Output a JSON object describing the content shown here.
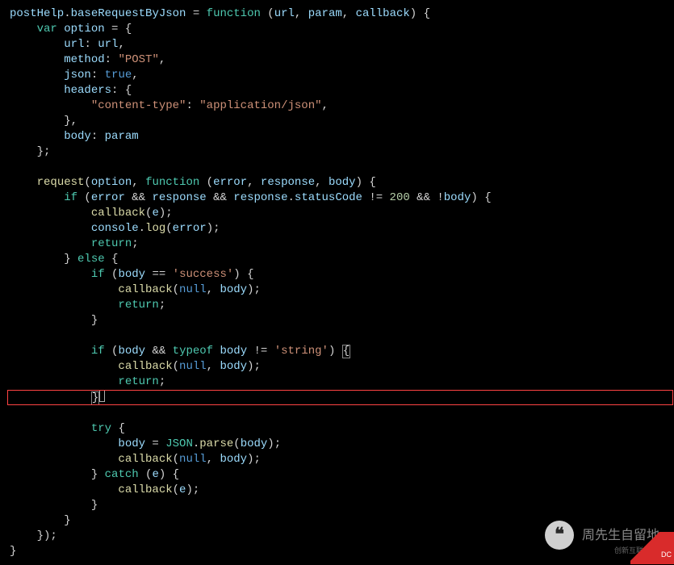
{
  "code_lines": [
    {
      "indent": 0,
      "tokens": [
        {
          "t": "prop",
          "v": "postHelp"
        },
        {
          "t": "punct",
          "v": "."
        },
        {
          "t": "prop",
          "v": "baseRequestByJson"
        },
        {
          "t": "punct",
          "v": " = "
        },
        {
          "t": "kw",
          "v": "function"
        },
        {
          "t": "punct",
          "v": " ("
        },
        {
          "t": "prop",
          "v": "url"
        },
        {
          "t": "punct",
          "v": ", "
        },
        {
          "t": "prop",
          "v": "param"
        },
        {
          "t": "punct",
          "v": ", "
        },
        {
          "t": "prop",
          "v": "callback"
        },
        {
          "t": "punct",
          "v": ") {"
        }
      ]
    },
    {
      "indent": 1,
      "tokens": [
        {
          "t": "kw",
          "v": "var"
        },
        {
          "t": "punct",
          "v": " "
        },
        {
          "t": "prop",
          "v": "option"
        },
        {
          "t": "punct",
          "v": " = {"
        }
      ]
    },
    {
      "indent": 2,
      "tokens": [
        {
          "t": "prop",
          "v": "url"
        },
        {
          "t": "punct",
          "v": ": "
        },
        {
          "t": "prop",
          "v": "url"
        },
        {
          "t": "punct",
          "v": ","
        }
      ]
    },
    {
      "indent": 2,
      "tokens": [
        {
          "t": "prop",
          "v": "method"
        },
        {
          "t": "punct",
          "v": ": "
        },
        {
          "t": "str",
          "v": "\"POST\""
        },
        {
          "t": "punct",
          "v": ","
        }
      ]
    },
    {
      "indent": 2,
      "tokens": [
        {
          "t": "prop",
          "v": "json"
        },
        {
          "t": "punct",
          "v": ": "
        },
        {
          "t": "null",
          "v": "true"
        },
        {
          "t": "punct",
          "v": ","
        }
      ]
    },
    {
      "indent": 2,
      "tokens": [
        {
          "t": "prop",
          "v": "headers"
        },
        {
          "t": "punct",
          "v": ": {"
        }
      ]
    },
    {
      "indent": 3,
      "tokens": [
        {
          "t": "str",
          "v": "\"content-type\""
        },
        {
          "t": "punct",
          "v": ": "
        },
        {
          "t": "str",
          "v": "\"application/json\""
        },
        {
          "t": "punct",
          "v": ","
        }
      ]
    },
    {
      "indent": 2,
      "tokens": [
        {
          "t": "punct",
          "v": "},"
        }
      ]
    },
    {
      "indent": 2,
      "tokens": [
        {
          "t": "prop",
          "v": "body"
        },
        {
          "t": "punct",
          "v": ": "
        },
        {
          "t": "prop",
          "v": "param"
        }
      ]
    },
    {
      "indent": 1,
      "tokens": [
        {
          "t": "punct",
          "v": "};"
        }
      ]
    },
    {
      "indent": 0,
      "tokens": []
    },
    {
      "indent": 1,
      "tokens": [
        {
          "t": "fn",
          "v": "request"
        },
        {
          "t": "punct",
          "v": "("
        },
        {
          "t": "prop",
          "v": "option"
        },
        {
          "t": "punct",
          "v": ", "
        },
        {
          "t": "kw",
          "v": "function"
        },
        {
          "t": "punct",
          "v": " ("
        },
        {
          "t": "prop",
          "v": "error"
        },
        {
          "t": "punct",
          "v": ", "
        },
        {
          "t": "prop",
          "v": "response"
        },
        {
          "t": "punct",
          "v": ", "
        },
        {
          "t": "prop",
          "v": "body"
        },
        {
          "t": "punct",
          "v": ") {"
        }
      ]
    },
    {
      "indent": 2,
      "tokens": [
        {
          "t": "kw",
          "v": "if"
        },
        {
          "t": "punct",
          "v": " ("
        },
        {
          "t": "prop",
          "v": "error"
        },
        {
          "t": "punct",
          "v": " && "
        },
        {
          "t": "prop",
          "v": "response"
        },
        {
          "t": "punct",
          "v": " && "
        },
        {
          "t": "prop",
          "v": "response"
        },
        {
          "t": "punct",
          "v": "."
        },
        {
          "t": "prop",
          "v": "statusCode"
        },
        {
          "t": "punct",
          "v": " != "
        },
        {
          "t": "num",
          "v": "200"
        },
        {
          "t": "punct",
          "v": " && !"
        },
        {
          "t": "prop",
          "v": "body"
        },
        {
          "t": "punct",
          "v": ") {"
        }
      ]
    },
    {
      "indent": 3,
      "tokens": [
        {
          "t": "fn",
          "v": "callback"
        },
        {
          "t": "punct",
          "v": "("
        },
        {
          "t": "prop",
          "v": "e"
        },
        {
          "t": "punct",
          "v": ");"
        }
      ]
    },
    {
      "indent": 3,
      "tokens": [
        {
          "t": "prop",
          "v": "console"
        },
        {
          "t": "punct",
          "v": "."
        },
        {
          "t": "fn",
          "v": "log"
        },
        {
          "t": "punct",
          "v": "("
        },
        {
          "t": "prop",
          "v": "error"
        },
        {
          "t": "punct",
          "v": ");"
        }
      ]
    },
    {
      "indent": 3,
      "tokens": [
        {
          "t": "kw",
          "v": "return"
        },
        {
          "t": "punct",
          "v": ";"
        }
      ]
    },
    {
      "indent": 2,
      "tokens": [
        {
          "t": "punct",
          "v": "} "
        },
        {
          "t": "kw",
          "v": "else"
        },
        {
          "t": "punct",
          "v": " {"
        }
      ]
    },
    {
      "indent": 3,
      "tokens": [
        {
          "t": "kw",
          "v": "if"
        },
        {
          "t": "punct",
          "v": " ("
        },
        {
          "t": "prop",
          "v": "body"
        },
        {
          "t": "punct",
          "v": " == "
        },
        {
          "t": "str",
          "v": "'success'"
        },
        {
          "t": "punct",
          "v": ") {"
        }
      ]
    },
    {
      "indent": 4,
      "tokens": [
        {
          "t": "fn",
          "v": "callback"
        },
        {
          "t": "punct",
          "v": "("
        },
        {
          "t": "null",
          "v": "null"
        },
        {
          "t": "punct",
          "v": ", "
        },
        {
          "t": "prop",
          "v": "body"
        },
        {
          "t": "punct",
          "v": ");"
        }
      ]
    },
    {
      "indent": 4,
      "tokens": [
        {
          "t": "kw",
          "v": "return"
        },
        {
          "t": "punct",
          "v": ";"
        }
      ]
    },
    {
      "indent": 3,
      "tokens": [
        {
          "t": "punct",
          "v": "}"
        }
      ]
    },
    {
      "indent": 0,
      "tokens": []
    },
    {
      "indent": 3,
      "tokens": [
        {
          "t": "kw",
          "v": "if"
        },
        {
          "t": "punct",
          "v": " ("
        },
        {
          "t": "prop",
          "v": "body"
        },
        {
          "t": "punct",
          "v": " && "
        },
        {
          "t": "kw",
          "v": "typeof"
        },
        {
          "t": "punct",
          "v": " "
        },
        {
          "t": "prop",
          "v": "body"
        },
        {
          "t": "punct",
          "v": " != "
        },
        {
          "t": "str",
          "v": "'string'"
        },
        {
          "t": "punct",
          "v": ") "
        },
        {
          "t": "bracket",
          "v": "{"
        }
      ]
    },
    {
      "indent": 4,
      "tokens": [
        {
          "t": "fn",
          "v": "callback"
        },
        {
          "t": "punct",
          "v": "("
        },
        {
          "t": "null",
          "v": "null"
        },
        {
          "t": "punct",
          "v": ", "
        },
        {
          "t": "prop",
          "v": "body"
        },
        {
          "t": "punct",
          "v": ");"
        }
      ]
    },
    {
      "indent": 4,
      "tokens": [
        {
          "t": "kw",
          "v": "return"
        },
        {
          "t": "punct",
          "v": ";"
        }
      ]
    },
    {
      "indent": 3,
      "tokens": [
        {
          "t": "cursor",
          "v": "}"
        }
      ]
    },
    {
      "indent": 0,
      "tokens": []
    },
    {
      "indent": 3,
      "tokens": [
        {
          "t": "kw",
          "v": "try"
        },
        {
          "t": "punct",
          "v": " {"
        }
      ]
    },
    {
      "indent": 4,
      "tokens": [
        {
          "t": "prop",
          "v": "body"
        },
        {
          "t": "punct",
          "v": " = "
        },
        {
          "t": "obj",
          "v": "JSON"
        },
        {
          "t": "punct",
          "v": "."
        },
        {
          "t": "fn",
          "v": "parse"
        },
        {
          "t": "punct",
          "v": "("
        },
        {
          "t": "prop",
          "v": "body"
        },
        {
          "t": "punct",
          "v": ");"
        }
      ]
    },
    {
      "indent": 4,
      "tokens": [
        {
          "t": "fn",
          "v": "callback"
        },
        {
          "t": "punct",
          "v": "("
        },
        {
          "t": "null",
          "v": "null"
        },
        {
          "t": "punct",
          "v": ", "
        },
        {
          "t": "prop",
          "v": "body"
        },
        {
          "t": "punct",
          "v": ");"
        }
      ]
    },
    {
      "indent": 3,
      "tokens": [
        {
          "t": "punct",
          "v": "} "
        },
        {
          "t": "kw",
          "v": "catch"
        },
        {
          "t": "punct",
          "v": " ("
        },
        {
          "t": "prop",
          "v": "e"
        },
        {
          "t": "punct",
          "v": ") {"
        }
      ]
    },
    {
      "indent": 4,
      "tokens": [
        {
          "t": "fn",
          "v": "callback"
        },
        {
          "t": "punct",
          "v": "("
        },
        {
          "t": "prop",
          "v": "e"
        },
        {
          "t": "punct",
          "v": ");"
        }
      ]
    },
    {
      "indent": 3,
      "tokens": [
        {
          "t": "punct",
          "v": "}"
        }
      ]
    },
    {
      "indent": 2,
      "tokens": [
        {
          "t": "punct",
          "v": "}"
        }
      ]
    },
    {
      "indent": 1,
      "tokens": [
        {
          "t": "punct",
          "v": "});"
        }
      ]
    },
    {
      "indent": 0,
      "tokens": [
        {
          "t": "punct",
          "v": "}"
        }
      ]
    }
  ],
  "indent_unit": "    ",
  "watermark": {
    "icon_glyph": "❝",
    "text": "周先生自留地",
    "brand_small": "创新互联",
    "brand_logo": "DC"
  }
}
